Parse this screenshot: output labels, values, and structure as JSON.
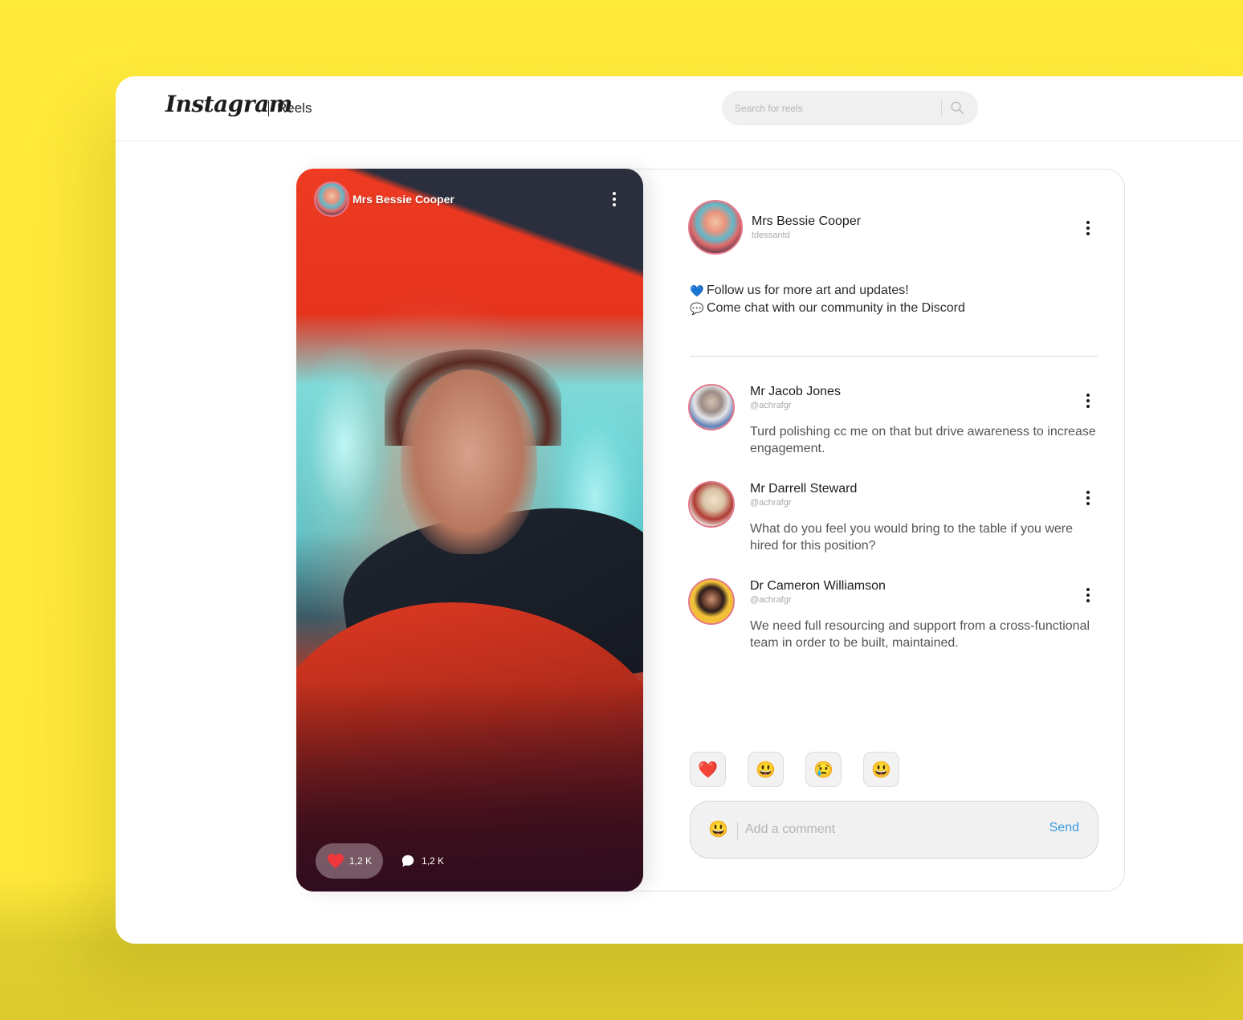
{
  "app": {
    "brand": "Instagram",
    "section": "Reels"
  },
  "search": {
    "placeholder": "Search for reels",
    "icon": "search-icon"
  },
  "reel": {
    "author_name": "Mrs Bessie Cooper",
    "likes": "1,2 K",
    "comments": "1,2 K",
    "like_icon": "heart-icon",
    "comment_icon": "speech-bubble-icon",
    "menu_icon": "kebab-menu-icon"
  },
  "post": {
    "author_name": "Mrs Bessie Cooper",
    "author_handle": "tdessantd",
    "bio": [
      {
        "emoji": "💙",
        "icon": "blue-heart-icon",
        "text": "Follow us for more art and updates!"
      },
      {
        "emoji": "💬",
        "icon": "speech-bubble-icon",
        "text": "Come chat with our community in the Discord"
      }
    ]
  },
  "comments": [
    {
      "name": "Mr Jacob Jones",
      "handle": "@achrafgr",
      "text": "Turd polishing cc me on that but drive awareness to increase engagement."
    },
    {
      "name": "Mr Darrell Steward",
      "handle": "@achrafgr",
      "text": "What do you feel you would bring to the table if you were hired for this position?"
    },
    {
      "name": "Dr Cameron Williamson",
      "handle": "@achrafgr",
      "text": "We need full resourcing and support from a cross-functional team in order to be built, maintained."
    }
  ],
  "reactions": [
    {
      "emoji": "❤️",
      "name": "heart-reaction"
    },
    {
      "emoji": "😃",
      "name": "smile-reaction"
    },
    {
      "emoji": "😢",
      "name": "cry-reaction"
    },
    {
      "emoji": "😃",
      "name": "grin-reaction"
    }
  ],
  "composer": {
    "emoji": "😃",
    "placeholder": "Add a comment",
    "send_label": "Send",
    "send_color": "#3a9be0"
  },
  "colors": {
    "background": "#ffea3a",
    "accent_link": "#3a9be0",
    "avatar_ring": "#e37a8c",
    "like_red": "#f0373c"
  }
}
